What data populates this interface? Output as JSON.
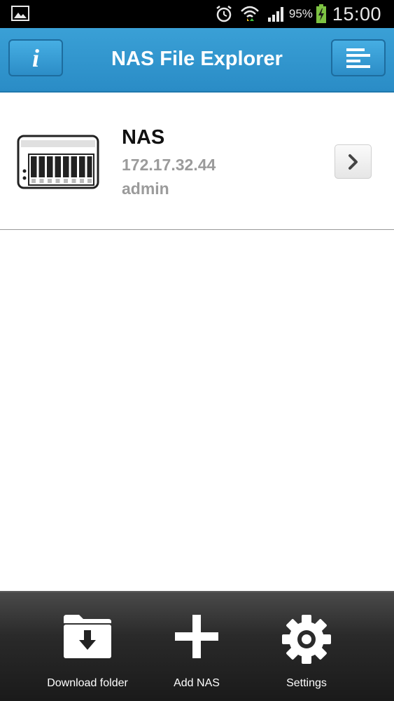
{
  "status_bar": {
    "icons": [
      "gallery-notification-icon",
      "alarm-icon",
      "wifi-icon",
      "signal-icon",
      "battery-icon"
    ],
    "battery_percent": "95%",
    "time": "15:00"
  },
  "header": {
    "title": "NAS File Explorer",
    "info_icon": "info-icon",
    "menu_icon": "menu-icon",
    "accent_color": "#2a8cc6"
  },
  "nas_list": [
    {
      "name": "NAS",
      "ip": "172.17.32.44",
      "user": "admin",
      "icon": "nas-device-icon"
    }
  ],
  "toolbar": {
    "items": [
      {
        "label": "Download folder",
        "icon": "download-folder-icon"
      },
      {
        "label": "Add NAS",
        "icon": "plus-icon"
      },
      {
        "label": "Settings",
        "icon": "gear-icon"
      }
    ]
  }
}
